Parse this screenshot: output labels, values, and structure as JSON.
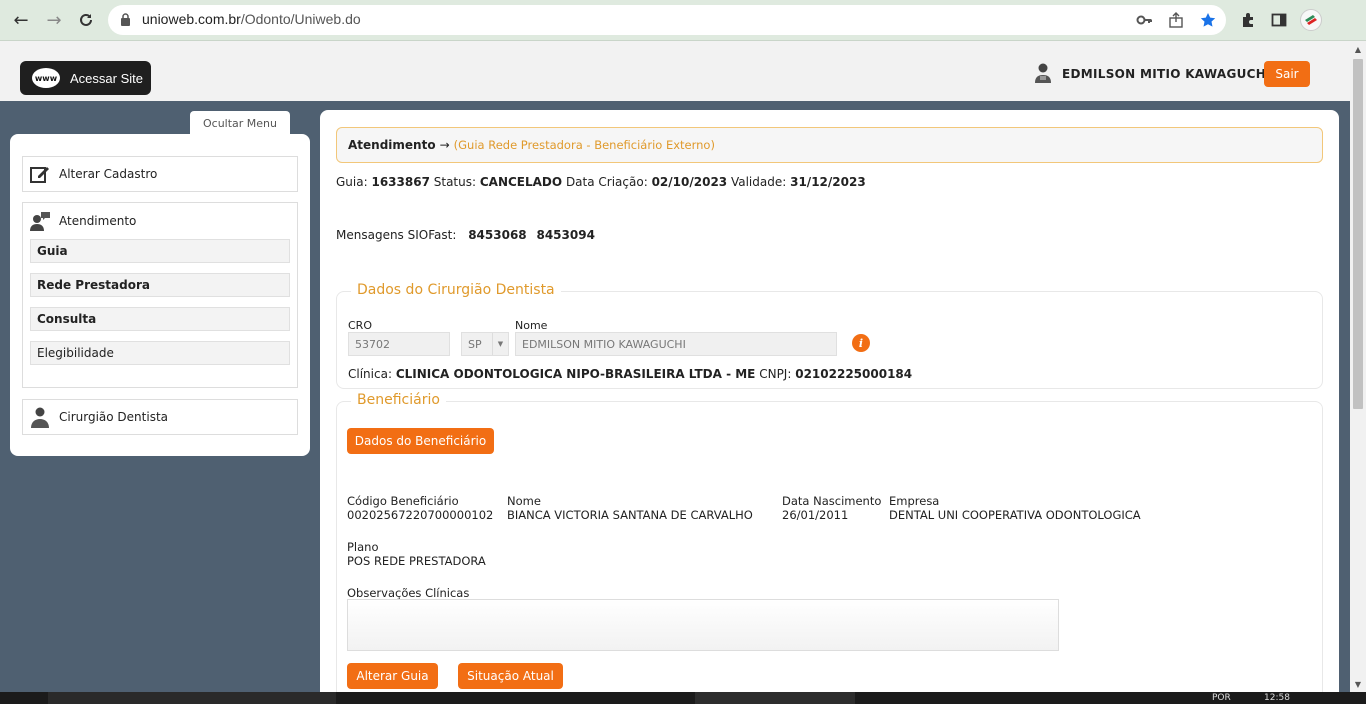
{
  "browser": {
    "url_host": "unioweb.com.br",
    "url_path": "/Odonto/Uniweb.do"
  },
  "header": {
    "site_button_label": "Acessar Site",
    "globe_text": "www",
    "user_name": "EDMILSON MITIO KAWAGUCHI",
    "logout_label": "Sair"
  },
  "sidebar": {
    "hide_menu_label": "Ocultar Menu",
    "alter_cadastro": "Alterar Cadastro",
    "atendimento": "Atendimento",
    "sub_items": [
      "Guia",
      "Rede Prestadora",
      "Consulta",
      "Elegibilidade"
    ],
    "cirurgiao": "Cirurgião Dentista"
  },
  "main": {
    "breadcrumb_title": "Atendimento",
    "breadcrumb_arrow": "→",
    "breadcrumb_sub": "(Guia Rede Prestadora - Beneficiário Externo)",
    "guia_label": "Guia:",
    "guia_value": "1633867",
    "status_label": "Status:",
    "status_value": "CANCELADO",
    "data_criacao_label": "Data Criação:",
    "data_criacao_value": "02/10/2023",
    "validade_label": "Validade:",
    "validade_value": "31/12/2023",
    "mensagens_label": "Mensagens SIOFast:",
    "mensagens_values": [
      "8453068",
      "8453094"
    ],
    "dentista": {
      "legend": "Dados do Cirurgião Dentista",
      "cro_label": "CRO",
      "cro_value": "53702",
      "uf_value": "SP",
      "nome_label": "Nome",
      "nome_value": "EDMILSON MITIO KAWAGUCHI",
      "info_glyph": "i",
      "clinica_label": "Clínica:",
      "clinica_value": "CLINICA ODONTOLOGICA NIPO-BRASILEIRA LTDA - ME",
      "cnpj_label": "CNPJ:",
      "cnpj_value": "02102225000184"
    },
    "beneficiario": {
      "legend": "Beneficiário",
      "dados_button": "Dados do Beneficiário",
      "codigo_label": "Código Beneficiário",
      "codigo_value": "00202567220700000102",
      "nome_label": "Nome",
      "nome_value": "BIANCA VICTORIA SANTANA DE CARVALHO",
      "nasc_label": "Data Nascimento",
      "nasc_value": "26/01/2011",
      "empresa_label": "Empresa",
      "empresa_value": "DENTAL UNI COOPERATIVA ODONTOLOGICA",
      "plano_label": "Plano",
      "plano_value": "POS REDE PRESTADORA",
      "obs_label": "Observações Clínicas",
      "obs_value": ""
    },
    "alterar_guia_button": "Alterar Guia",
    "situacao_button": "Situação Atual"
  },
  "taskbar": {
    "lang": "POR",
    "time": "12:58"
  },
  "colors": {
    "accent_orange": "#f26e14",
    "legend_orange": "#e09a2c",
    "page_bg": "#4f6071"
  }
}
